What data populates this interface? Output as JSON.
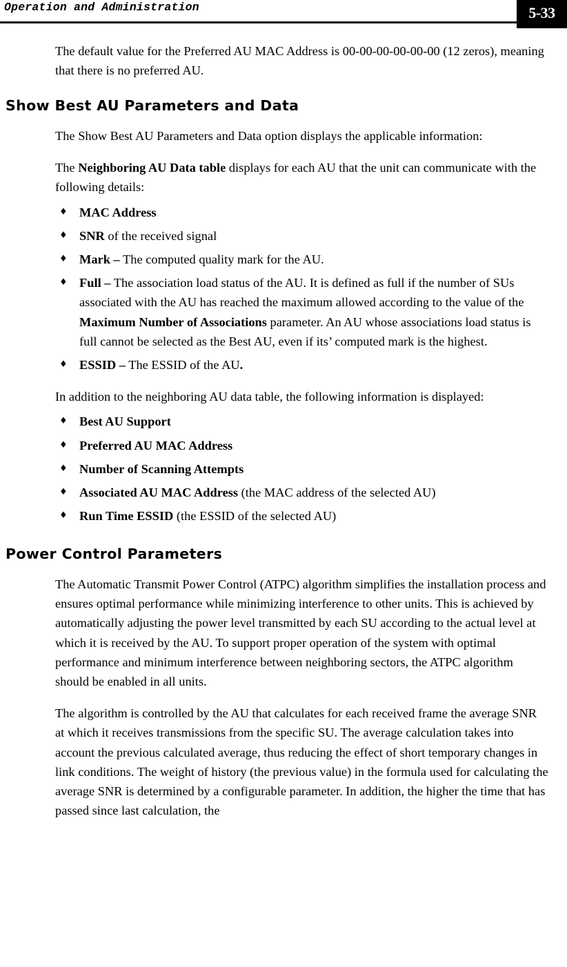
{
  "header": {
    "title": "Operation and Administration",
    "page_number": "5-33"
  },
  "content": {
    "intro_paragraph": "The default value for the Preferred AU MAC Address is 00-00-00-00-00-00 (12 zeros), meaning that there is no preferred AU.",
    "section_show_best_au": {
      "heading": "Show Best AU Parameters and Data",
      "paragraph_1": "The Show Best AU Parameters and Data option displays the applicable information:",
      "paragraph_2_pre": "The ",
      "paragraph_2_bold": "Neighboring AU Data table",
      "paragraph_2_post": " displays for each AU that the unit can communicate with the following details:",
      "bullets": [
        {
          "glyph": "♦",
          "bold": "MAC Address",
          "rest": ""
        },
        {
          "glyph": "♦",
          "bold": "SNR",
          "rest": " of the received signal"
        },
        {
          "glyph": "♦",
          "bold": "Mark –",
          "rest": " The computed quality mark for the AU."
        },
        {
          "glyph": "♦",
          "bold": "Full –",
          "rest": " The association load status of the AU. It is defined as full if the number of SUs associated with the AU has reached the maximum allowed according to the value of the ",
          "bold2": "Maximum Number of Associations",
          "rest2": " parameter. An AU whose associations load status is full cannot be selected as the Best AU, even if its’ computed mark is the highest."
        },
        {
          "glyph": "♦",
          "bold": "ESSID –",
          "rest": " The ESSID of the AU",
          "bold2": ".",
          "rest2": ""
        }
      ],
      "paragraph_3": "In addition to the neighboring AU data table, the following information is displayed:",
      "bullets_2": [
        {
          "glyph": "♦",
          "bold": "Best AU Support",
          "rest": ""
        },
        {
          "glyph": "♦",
          "bold": "Preferred AU MAC Address",
          "rest": ""
        },
        {
          "glyph": "♦",
          "bold": "Number of Scanning Attempts",
          "rest": ""
        },
        {
          "glyph": "♦",
          "bold": "Associated AU MAC Address",
          "rest": " (the MAC address of the selected AU)"
        },
        {
          "glyph": "♦",
          "bold": "Run Time ESSID",
          "rest": " (the ESSID of the selected AU)"
        }
      ]
    },
    "section_power_control": {
      "heading": "Power Control Parameters",
      "paragraph_1": " The Automatic Transmit Power Control (ATPC) algorithm simplifies the installation process and ensures optimal performance while minimizing interference to other units. This is achieved by automatically adjusting the power level transmitted by each SU according to the actual level at which it is received by the AU. To support proper operation of the system with optimal performance and minimum interference between neighboring sectors, the ATPC algorithm should be enabled in all units.",
      "paragraph_2": "The algorithm is controlled by the AU that calculates for each received frame the average SNR at which it receives transmissions from the specific SU. The average calculation takes into account the previous calculated average, thus reducing the effect of short temporary changes in link conditions. The weight of history (the previous value) in the formula used for calculating the average SNR is determined by a configurable parameter. In addition, the higher the time that has passed since last calculation, the"
    }
  }
}
